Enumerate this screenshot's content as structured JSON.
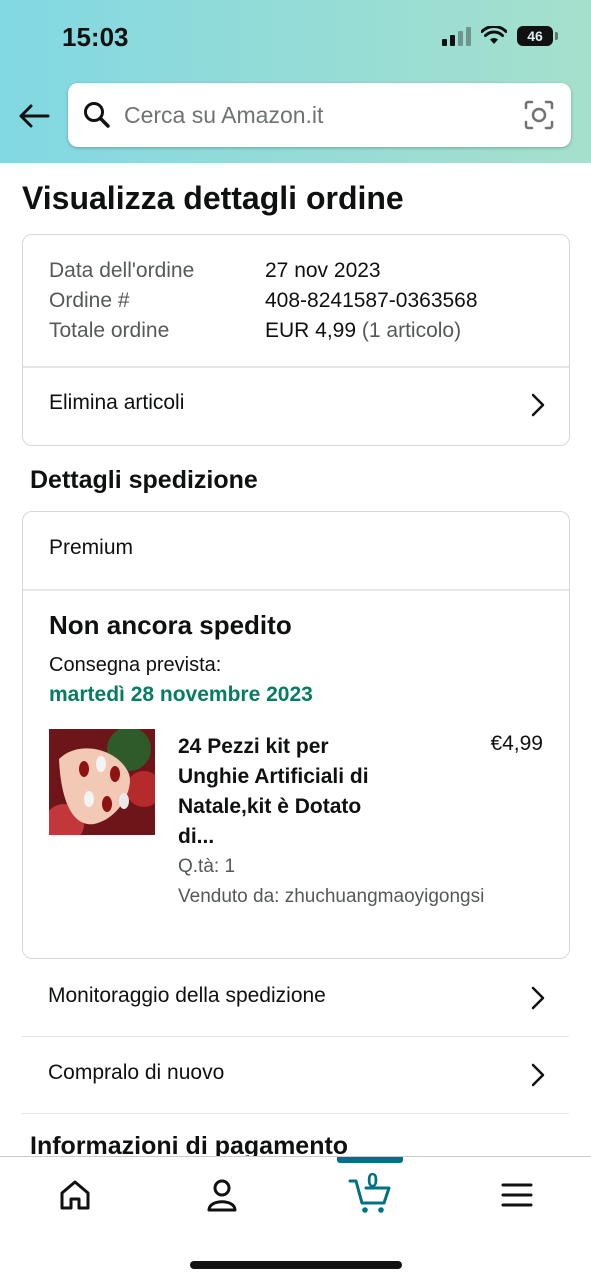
{
  "status_bar": {
    "time": "15:03",
    "battery": "46"
  },
  "search": {
    "placeholder": "Cerca su Amazon.it"
  },
  "page_title": "Visualizza dettagli ordine",
  "order_info": {
    "rows": [
      {
        "label": "Data dell'ordine",
        "value": "27 nov 2023"
      },
      {
        "label": "Ordine #",
        "value": "408-8241587-0363568"
      },
      {
        "label": "Totale ordine",
        "value": "EUR 4,99",
        "note": "(1 articolo)"
      }
    ],
    "delete_items": "Elimina articoli"
  },
  "shipping": {
    "section_title": "Dettagli spedizione",
    "service": "Premium",
    "status": "Non ancora spedito",
    "delivery_label": "Consegna prevista:",
    "delivery_date": "martedì 28 novembre 2023",
    "item": {
      "title_lines": [
        "24 Pezzi kit per",
        "Unghie Artificiali di",
        "Natale,kit è Dotato",
        "di..."
      ],
      "price": "€4,99",
      "qty": "Q.tà: 1",
      "seller": "Venduto da: zhuchuangmaoyigongsi"
    }
  },
  "actions": {
    "track": "Monitoraggio della spedizione",
    "buy_again": "Compralo di nuovo"
  },
  "payment_title": "Informazioni di pagamento",
  "bottom_nav": {
    "cart_count": "0"
  },
  "colors": {
    "accent": "#007185",
    "delivery": "#067d62"
  }
}
